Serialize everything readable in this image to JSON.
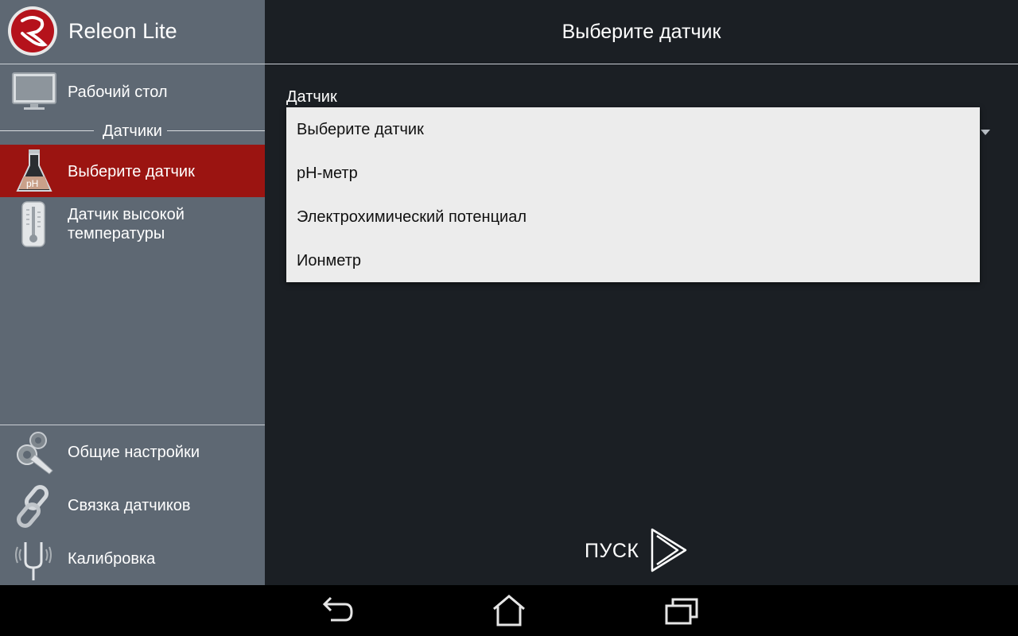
{
  "app": {
    "title": "Releon Lite"
  },
  "sidebar": {
    "desktop_label": "Рабочий стол",
    "section_title": "Датчики",
    "sensors": [
      {
        "label": "Выберите датчик",
        "icon": "ph-flask-icon",
        "active": true
      },
      {
        "label": "Датчик высокой\nтемпературы",
        "icon": "thermometer-icon",
        "active": false
      }
    ],
    "bottom": [
      {
        "label": "Общие настройки",
        "icon": "gears-wrench-icon"
      },
      {
        "label": "Связка датчиков",
        "icon": "chain-link-icon"
      },
      {
        "label": "Калибровка",
        "icon": "tuning-fork-icon"
      }
    ]
  },
  "main": {
    "title": "Выберите датчик",
    "field_label": "Датчик",
    "dropdown_options": [
      "Выберите датчик",
      "pH-метр",
      "Электрохимический потенциал",
      "Ионметр"
    ],
    "start_label": "ПУСК"
  },
  "colors": {
    "sidebar_bg": "#5e6873",
    "active_item": "#9b1411",
    "main_bg": "#1b1f24",
    "dropdown_bg": "#ececec"
  },
  "system_bar": {
    "icons": [
      "back-icon",
      "home-icon",
      "recent-apps-icon"
    ]
  }
}
